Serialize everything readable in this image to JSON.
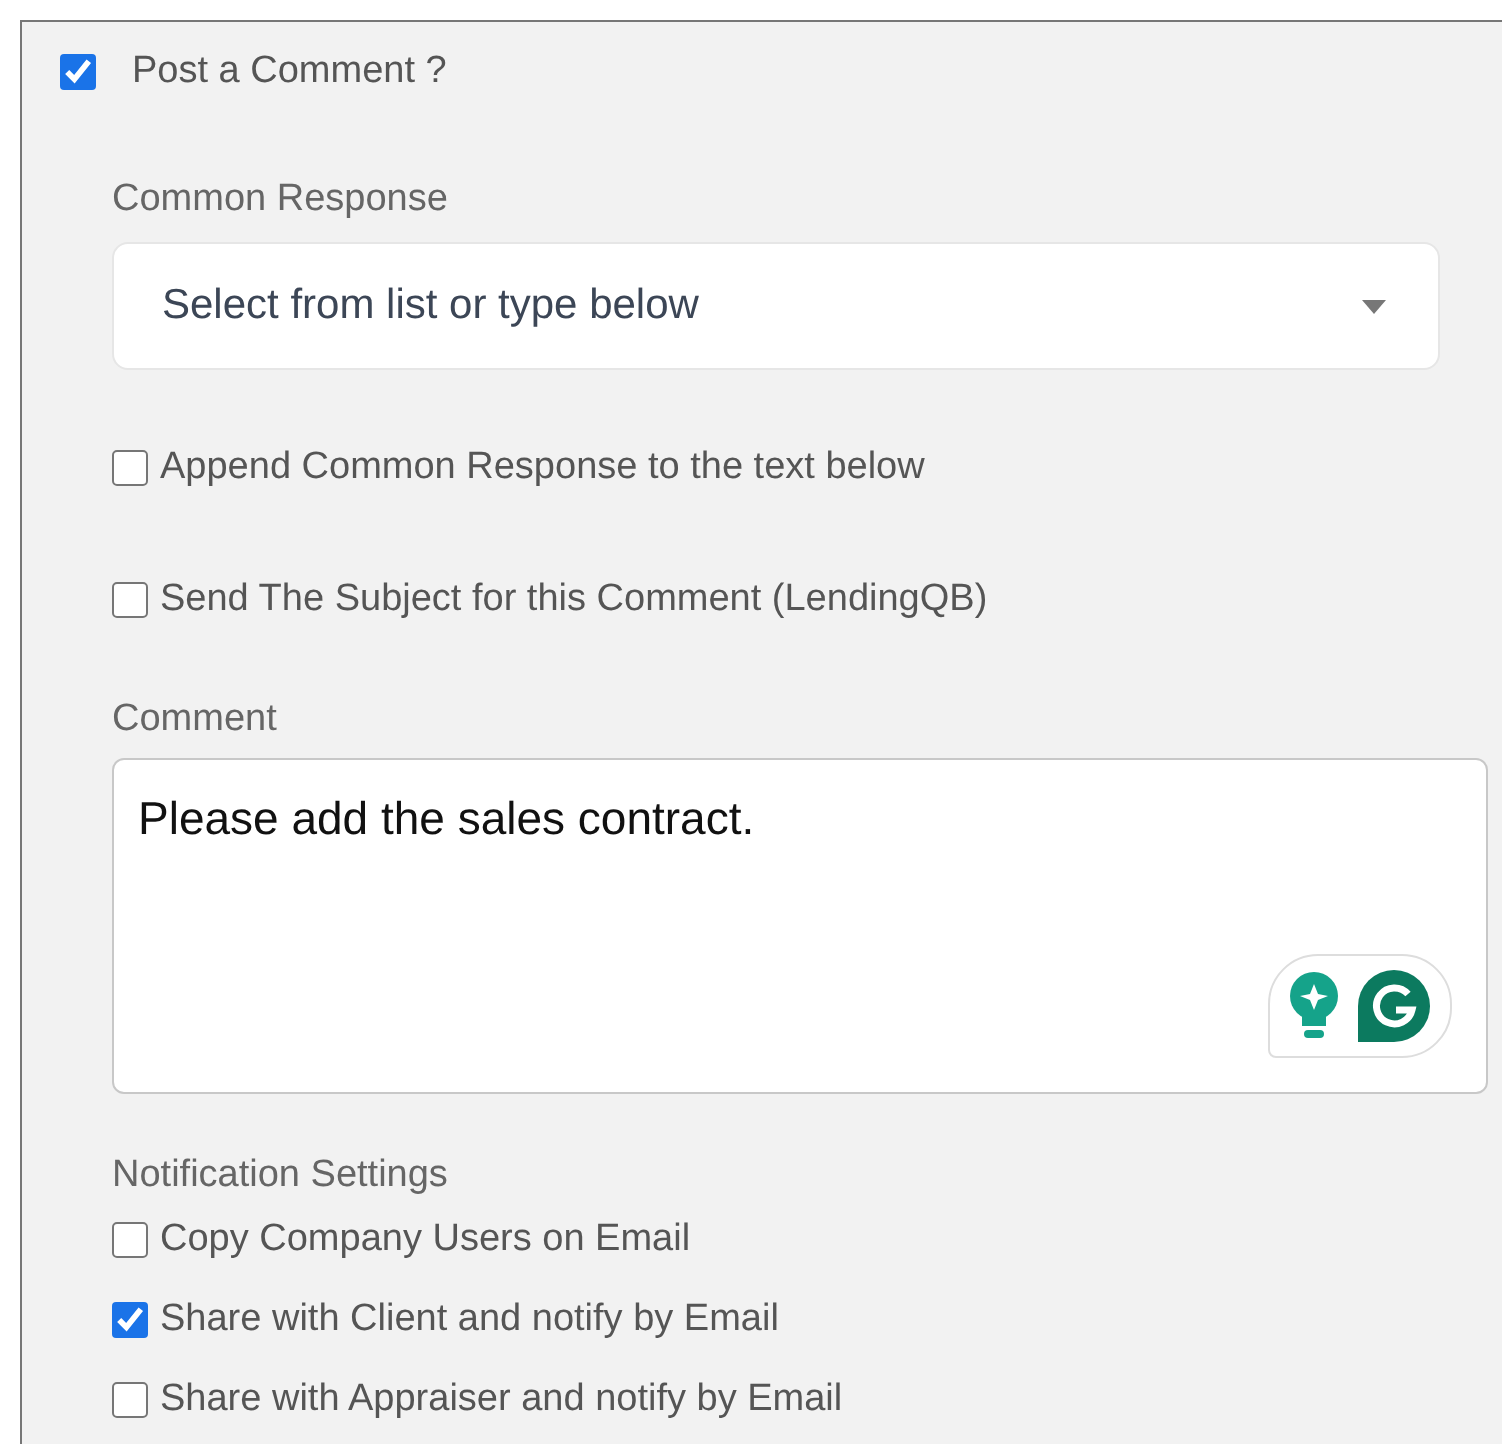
{
  "post_comment": {
    "label": "Post a Comment ?",
    "checked": true
  },
  "common_response": {
    "label": "Common Response",
    "placeholder": "Select from list or type below"
  },
  "options": [
    {
      "label": "Append Common Response to the text below",
      "checked": false
    },
    {
      "label": "Send The Subject for this Comment (LendingQB)",
      "checked": false
    }
  ],
  "comment": {
    "label": "Comment",
    "value": "Please add the sales contract."
  },
  "notification_settings": {
    "label": "Notification Settings",
    "items": [
      {
        "label": "Copy Company Users on Email",
        "checked": false
      },
      {
        "label": "Share with Client and notify by Email",
        "checked": true
      },
      {
        "label": "Share with Appraiser and notify by Email",
        "checked": false
      }
    ]
  }
}
